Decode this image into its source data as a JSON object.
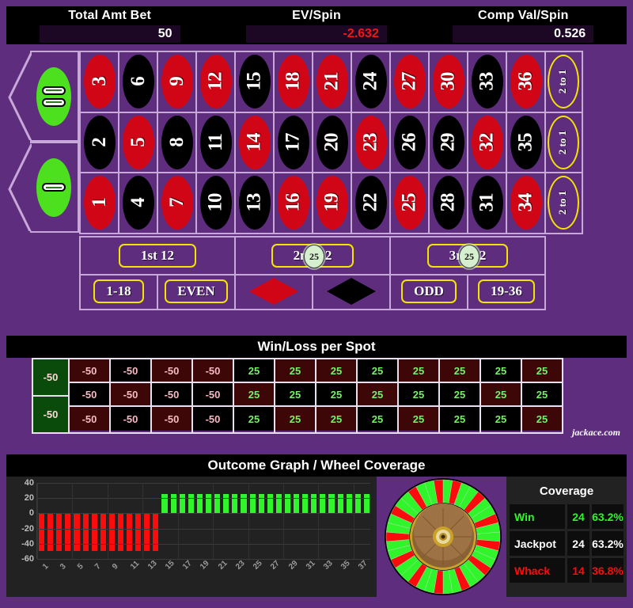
{
  "stats": [
    {
      "label": "Total Amt Bet",
      "value": "50",
      "negative": false
    },
    {
      "label": "EV/Spin",
      "value": "-2.632",
      "negative": true
    },
    {
      "label": "Comp Val/Spin",
      "value": "0.526",
      "negative": false
    }
  ],
  "board": {
    "zeros": [
      {
        "label": "00",
        "bars": 2
      },
      {
        "label": "0",
        "bars": 1
      }
    ],
    "rows": [
      {
        "numbers": [
          {
            "n": "3",
            "color": "red"
          },
          {
            "n": "6",
            "color": "black"
          },
          {
            "n": "9",
            "color": "red"
          },
          {
            "n": "12",
            "color": "red"
          },
          {
            "n": "15",
            "color": "black"
          },
          {
            "n": "18",
            "color": "red"
          },
          {
            "n": "21",
            "color": "red"
          },
          {
            "n": "24",
            "color": "black"
          },
          {
            "n": "27",
            "color": "red"
          },
          {
            "n": "30",
            "color": "red"
          },
          {
            "n": "33",
            "color": "black"
          },
          {
            "n": "36",
            "color": "red"
          }
        ]
      },
      {
        "numbers": [
          {
            "n": "2",
            "color": "black"
          },
          {
            "n": "5",
            "color": "red"
          },
          {
            "n": "8",
            "color": "black"
          },
          {
            "n": "11",
            "color": "black"
          },
          {
            "n": "14",
            "color": "red"
          },
          {
            "n": "17",
            "color": "black"
          },
          {
            "n": "20",
            "color": "black"
          },
          {
            "n": "23",
            "color": "red"
          },
          {
            "n": "26",
            "color": "black"
          },
          {
            "n": "29",
            "color": "black"
          },
          {
            "n": "32",
            "color": "red"
          },
          {
            "n": "35",
            "color": "black"
          }
        ]
      },
      {
        "numbers": [
          {
            "n": "1",
            "color": "red"
          },
          {
            "n": "4",
            "color": "black"
          },
          {
            "n": "7",
            "color": "red"
          },
          {
            "n": "10",
            "color": "black"
          },
          {
            "n": "13",
            "color": "black"
          },
          {
            "n": "16",
            "color": "red"
          },
          {
            "n": "19",
            "color": "red"
          },
          {
            "n": "22",
            "color": "black"
          },
          {
            "n": "25",
            "color": "red"
          },
          {
            "n": "28",
            "color": "black"
          },
          {
            "n": "31",
            "color": "black"
          },
          {
            "n": "34",
            "color": "red"
          }
        ]
      }
    ],
    "column_bets": [
      "2 to 1",
      "2 to 1",
      "2 to 1"
    ],
    "dozens": [
      {
        "label": "1st 12",
        "chip": null
      },
      {
        "label": "2nd 12",
        "chip": "25"
      },
      {
        "label": "3rd 12",
        "chip": "25"
      }
    ],
    "outside": [
      {
        "type": "text",
        "label": "1-18"
      },
      {
        "type": "text",
        "label": "EVEN"
      },
      {
        "type": "diamond",
        "label": "red-diamond",
        "color": "red"
      },
      {
        "type": "diamond",
        "label": "black-diamond",
        "color": "black"
      },
      {
        "type": "text",
        "label": "ODD"
      },
      {
        "type": "text",
        "label": "19-36"
      }
    ]
  },
  "winloss": {
    "title": "Win/Loss per Spot",
    "watermark": "jackace.com",
    "zeros": [
      "-50",
      "-50"
    ],
    "rows": [
      {
        "cells": [
          {
            "v": "-50",
            "color": "red"
          },
          {
            "v": "-50",
            "color": "black"
          },
          {
            "v": "-50",
            "color": "red"
          },
          {
            "v": "-50",
            "color": "red"
          },
          {
            "v": "25",
            "color": "black"
          },
          {
            "v": "25",
            "color": "red"
          },
          {
            "v": "25",
            "color": "red"
          },
          {
            "v": "25",
            "color": "black"
          },
          {
            "v": "25",
            "color": "red"
          },
          {
            "v": "25",
            "color": "red"
          },
          {
            "v": "25",
            "color": "black"
          },
          {
            "v": "25",
            "color": "red"
          }
        ]
      },
      {
        "cells": [
          {
            "v": "-50",
            "color": "black"
          },
          {
            "v": "-50",
            "color": "red"
          },
          {
            "v": "-50",
            "color": "black"
          },
          {
            "v": "-50",
            "color": "black"
          },
          {
            "v": "25",
            "color": "red"
          },
          {
            "v": "25",
            "color": "black"
          },
          {
            "v": "25",
            "color": "black"
          },
          {
            "v": "25",
            "color": "red"
          },
          {
            "v": "25",
            "color": "black"
          },
          {
            "v": "25",
            "color": "black"
          },
          {
            "v": "25",
            "color": "red"
          },
          {
            "v": "25",
            "color": "black"
          }
        ]
      },
      {
        "cells": [
          {
            "v": "-50",
            "color": "red"
          },
          {
            "v": "-50",
            "color": "black"
          },
          {
            "v": "-50",
            "color": "red"
          },
          {
            "v": "-50",
            "color": "black"
          },
          {
            "v": "25",
            "color": "black"
          },
          {
            "v": "25",
            "color": "red"
          },
          {
            "v": "25",
            "color": "red"
          },
          {
            "v": "25",
            "color": "black"
          },
          {
            "v": "25",
            "color": "red"
          },
          {
            "v": "25",
            "color": "black"
          },
          {
            "v": "25",
            "color": "black"
          },
          {
            "v": "25",
            "color": "red"
          }
        ]
      }
    ]
  },
  "outcome": {
    "title": "Outcome Graph / Wheel Coverage",
    "coverage": {
      "title": "Coverage",
      "rows": [
        {
          "name": "Win",
          "count": "24",
          "pct": "63.2%",
          "tone": "g"
        },
        {
          "name": "Jackpot",
          "count": "24",
          "pct": "63.2%",
          "tone": "w"
        },
        {
          "name": "Whack",
          "count": "14",
          "pct": "36.8%",
          "tone": "r"
        }
      ]
    }
  },
  "chart_data": {
    "type": "bar",
    "title": "Outcome Graph / Wheel Coverage",
    "xlabel": "",
    "ylabel": "",
    "ylim": [
      -60,
      40
    ],
    "yticks": [
      40,
      20,
      0,
      -20,
      -40,
      -60
    ],
    "grid": true,
    "x": [
      1,
      2,
      3,
      4,
      5,
      6,
      7,
      8,
      9,
      10,
      11,
      12,
      13,
      14,
      15,
      16,
      17,
      18,
      19,
      20,
      21,
      22,
      23,
      24,
      25,
      26,
      27,
      28,
      29,
      30,
      31,
      32,
      33,
      34,
      35,
      36,
      37,
      38
    ],
    "xtick_labels": [
      "1",
      "3",
      "5",
      "7",
      "9",
      "11",
      "13",
      "15",
      "17",
      "19",
      "21",
      "23",
      "25",
      "27",
      "29",
      "31",
      "33",
      "35",
      "37"
    ],
    "values": [
      -50,
      -50,
      -50,
      -50,
      -50,
      -50,
      -50,
      -50,
      -50,
      -50,
      -50,
      -50,
      -50,
      -50,
      25,
      25,
      25,
      25,
      25,
      25,
      25,
      25,
      25,
      25,
      25,
      25,
      25,
      25,
      25,
      25,
      25,
      25,
      25,
      25,
      25,
      25,
      25,
      25
    ],
    "colors": {
      "negative": "#fa0c0c",
      "positive": "#2ff52a"
    }
  },
  "wheel": {
    "segments": 38,
    "win_color": "#2ff52a",
    "loss_color": "#fa0c0c",
    "pattern": [
      1,
      0,
      1,
      1,
      0,
      1,
      1,
      0,
      1,
      1,
      0,
      1,
      1,
      0,
      1,
      1,
      0,
      1,
      1,
      0,
      1,
      1,
      0,
      1,
      1,
      0,
      1,
      1,
      0,
      1,
      1,
      0,
      1,
      1,
      0,
      1,
      1,
      0
    ]
  }
}
